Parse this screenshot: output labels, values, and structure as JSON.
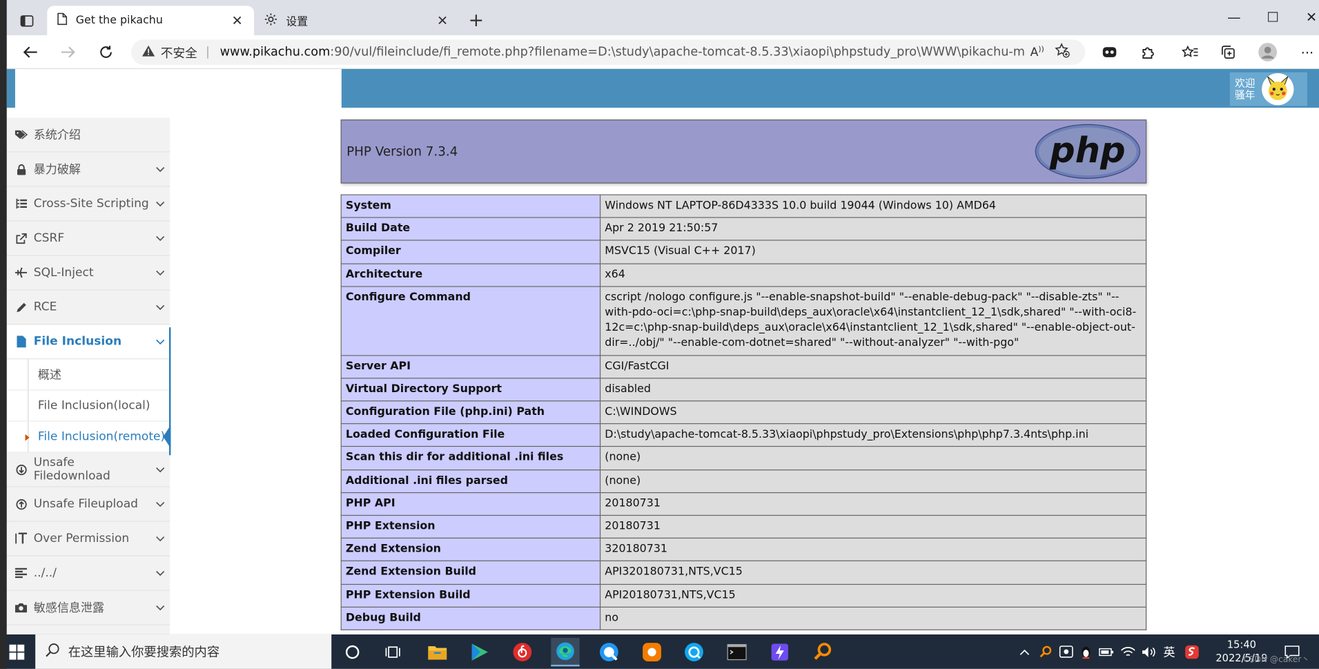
{
  "browser": {
    "tabs": [
      {
        "title": "Get the pikachu"
      },
      {
        "title": "设置"
      }
    ],
    "address": {
      "security_label": "不安全",
      "host": "www.pikachu.com",
      "path": ":90/vul/fileinclude/fi_remote.php?filename=D:\\study\\apache-tomcat-8.5.33\\xiaopi\\phpstudy_pro\\WWW\\pikachu-master/shell.txt..."
    },
    "window_controls": [
      "—",
      "☐",
      "✕"
    ]
  },
  "header": {
    "welcome_text": "欢迎骚年"
  },
  "sidebar": {
    "items": [
      {
        "label": "系统介绍",
        "icon": "tags-icon"
      },
      {
        "label": "暴力破解",
        "icon": "lock-icon"
      },
      {
        "label": "Cross-Site Scripting",
        "icon": "list-tree-icon"
      },
      {
        "label": "CSRF",
        "icon": "share-square-icon"
      },
      {
        "label": "SQL-Inject",
        "icon": "plane-icon"
      },
      {
        "label": "RCE",
        "icon": "pencil-icon"
      },
      {
        "label": "File Inclusion",
        "icon": "file-icon"
      },
      {
        "label": "Unsafe Filedownload",
        "icon": "download-circle-icon"
      },
      {
        "label": "Unsafe Fileupload",
        "icon": "upload-circle-icon"
      },
      {
        "label": "Over Permission",
        "icon": "text-height-icon"
      },
      {
        "label": "../../",
        "icon": "align-left-icon"
      },
      {
        "label": "敏感信息泄露",
        "icon": "camera-icon"
      }
    ],
    "sub_items": [
      {
        "label": "概述"
      },
      {
        "label": "File Inclusion(local)"
      },
      {
        "label": "File Inclusion(remote)"
      }
    ]
  },
  "phpinfo": {
    "version": "PHP Version 7.3.4",
    "logo_text": "php",
    "rows": [
      {
        "key": "System",
        "value": "Windows NT LAPTOP-86D4333S 10.0 build 19044 (Windows 10) AMD64"
      },
      {
        "key": "Build Date",
        "value": "Apr 2 2019 21:50:57"
      },
      {
        "key": "Compiler",
        "value": "MSVC15 (Visual C++ 2017)"
      },
      {
        "key": "Architecture",
        "value": "x64"
      },
      {
        "key": "Configure Command",
        "value": "cscript /nologo configure.js \"--enable-snapshot-build\" \"--enable-debug-pack\" \"--disable-zts\" \"--with-pdo-oci=c:\\php-snap-build\\deps_aux\\oracle\\x64\\instantclient_12_1\\sdk,shared\" \"--with-oci8-12c=c:\\php-snap-build\\deps_aux\\oracle\\x64\\instantclient_12_1\\sdk,shared\" \"--enable-object-out-dir=../obj/\" \"--enable-com-dotnet=shared\" \"--without-analyzer\" \"--with-pgo\""
      },
      {
        "key": "Server API",
        "value": "CGI/FastCGI"
      },
      {
        "key": "Virtual Directory Support",
        "value": "disabled"
      },
      {
        "key": "Configuration File (php.ini) Path",
        "value": "C:\\WINDOWS"
      },
      {
        "key": "Loaded Configuration File",
        "value": "D:\\study\\apache-tomcat-8.5.33\\xiaopi\\phpstudy_pro\\Extensions\\php\\php7.3.4nts\\php.ini"
      },
      {
        "key": "Scan this dir for additional .ini files",
        "value": "(none)"
      },
      {
        "key": "Additional .ini files parsed",
        "value": "(none)"
      },
      {
        "key": "PHP API",
        "value": "20180731"
      },
      {
        "key": "PHP Extension",
        "value": "20180731"
      },
      {
        "key": "Zend Extension",
        "value": "320180731"
      },
      {
        "key": "Zend Extension Build",
        "value": "API320180731,NTS,VC15"
      },
      {
        "key": "PHP Extension Build",
        "value": "API20180731,NTS,VC15"
      },
      {
        "key": "Debug Build",
        "value": "no"
      }
    ]
  },
  "taskbar": {
    "search_placeholder": "在这里输入你要搜索的内容",
    "ime_label": "英",
    "time": "15:40",
    "date": "2022/5/19",
    "watermark": "CSDN @caker丶"
  },
  "colors": {
    "header_blue": "#4a8fbb",
    "php_purple": "#9999cc",
    "php_key_bg": "#ccccff",
    "php_value_bg": "#dddddd",
    "active_blue": "#2b7dbc"
  }
}
